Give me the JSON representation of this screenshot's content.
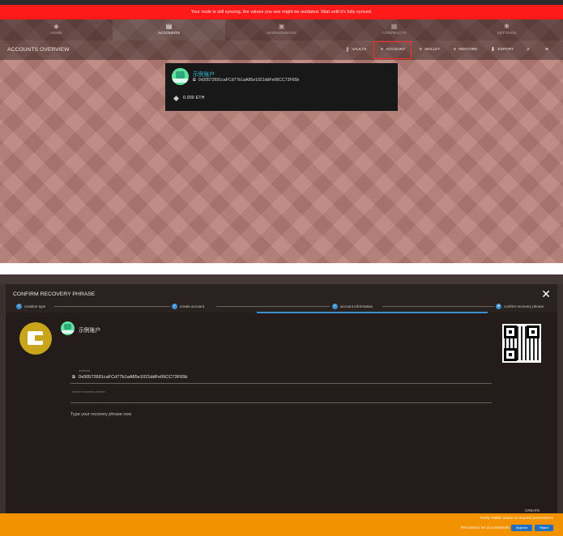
{
  "sync_banner": "Your node is still syncing, the values you see might be outdated. Wait until it's fully synced.",
  "tabs": [
    {
      "label": "HOME",
      "icon": "home-icon",
      "glyph": "◆"
    },
    {
      "label": "ACCOUNTS",
      "icon": "accounts-icon",
      "glyph": "▤",
      "active": true
    },
    {
      "label": "ADDRESSBOOK",
      "icon": "addressbook-icon",
      "glyph": "▣"
    },
    {
      "label": "CONTRACTS",
      "icon": "contracts-icon",
      "glyph": "▦"
    },
    {
      "label": "SETTINGS",
      "icon": "gear-icon",
      "glyph": "✱"
    }
  ],
  "subbar": {
    "title": "ACCOUNTS OVERVIEW",
    "actions": {
      "vaults": "VAULTS",
      "account": "ACCOUNT",
      "wallet": "WALLET",
      "restore": "RESTORE",
      "export": "EXPORT"
    }
  },
  "account_card": {
    "name": "示例账户",
    "address": "0x00572691caFCd77b1aA85e1021ddFe06CC73F65b",
    "balance": "0.000 ETH"
  },
  "dialog": {
    "title": "CONFIRM RECOVERY PHRASE",
    "steps": [
      "creation type",
      "create account",
      "account information",
      "confirm recovery phrase"
    ],
    "account_name": "示例账户",
    "address_label": "address",
    "address": "0x00572691caFCd77b1aA85e1021ddFe06CC73F65b",
    "recovery_label": "owner recovery phrase",
    "recovery_placeholder": "Type your recovery phrase now",
    "create_button": "CREATE"
  },
  "toast": {
    "message": "Parity Wallet wants to request permissions",
    "permission": "Permission for accountsEdit",
    "approve": "Approve",
    "reject": "Reject"
  },
  "colors": {
    "sync_banner_bg": "#ff1a1a",
    "accent_blue": "#3b8fd1",
    "toast_bg": "#f39200",
    "highlight_border": "#ff2a2a"
  }
}
